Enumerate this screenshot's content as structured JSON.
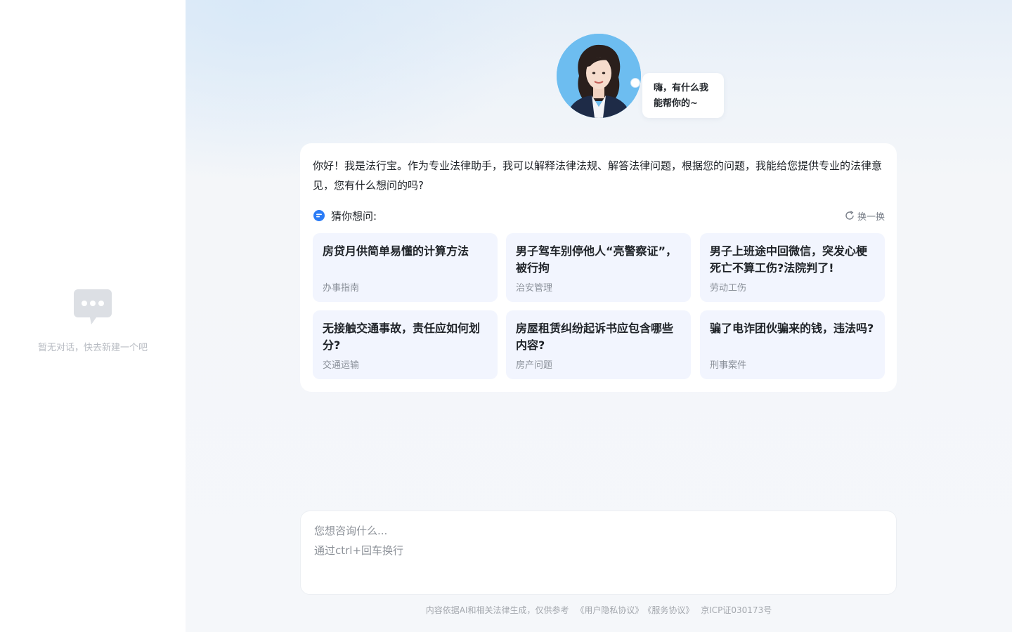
{
  "sidebar": {
    "empty_text": "暂无对话，快去新建一个吧",
    "empty_icon": "chat-bubble-icon"
  },
  "assistant": {
    "greeting": "嗨，有什么我能帮你的~",
    "greeting_line1": "嗨，有什么我",
    "greeting_line2": "能帮你的~"
  },
  "welcome": {
    "intro": "你好！我是法行宝。作为专业法律助手，我可以解释法律法规、解答法律问题，根据您的问题，我能给您提供专业的法律意见，您有什么想问的吗?",
    "guess_title": "猜你想问:",
    "refresh_label": "换一换",
    "questions": [
      {
        "title": "房贷月供简单易懂的计算方法",
        "tag": "办事指南"
      },
      {
        "title": "男子驾车别停他人“亮警察证”，被行拘",
        "tag": "治安管理"
      },
      {
        "title": "男子上班途中回微信，突发心梗死亡不算工伤?法院判了!",
        "tag": "劳动工伤"
      },
      {
        "title": "无接触交通事故，责任应如何划分?",
        "tag": "交通运输"
      },
      {
        "title": "房屋租赁纠纷起诉书应包含哪些内容?",
        "tag": "房产问题"
      },
      {
        "title": "骗了电诈团伙骗来的钱，违法吗?",
        "tag": "刑事案件"
      }
    ]
  },
  "input": {
    "placeholder": "您想咨询什么...\n通过ctrl+回车换行"
  },
  "footer": {
    "disclaimer": "内容依据AI和相关法律生成，仅供参考",
    "privacy_link": "《用户隐私协议》",
    "service_link": "《服务协议》",
    "icp": "京ICP证030173号"
  },
  "colors": {
    "card_bg": "#ffffff",
    "question_bg": "#f2f5fe",
    "accent": "#2b7cf6",
    "sidebar_bg": "#ffffff",
    "page_bg": "#f5f7fa"
  }
}
